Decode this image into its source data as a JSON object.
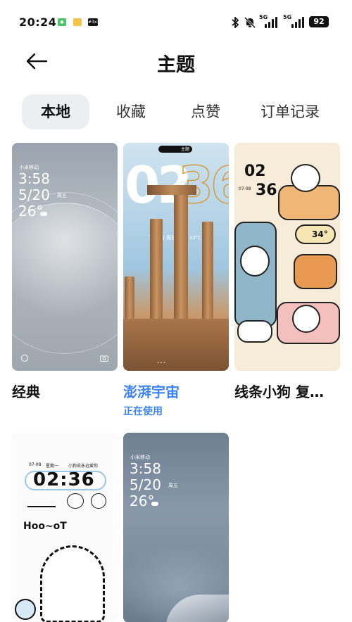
{
  "status_bar": {
    "time": "20:24",
    "notif_badge_3": "#3x3",
    "signal1_label": "5G",
    "signal2_label": "5G",
    "battery": "92"
  },
  "header": {
    "title": "主题"
  },
  "tabs": [
    {
      "label": "本地",
      "active": true
    },
    {
      "label": "收藏",
      "active": false
    },
    {
      "label": "点赞",
      "active": false
    },
    {
      "label": "订单记录",
      "active": false
    }
  ],
  "themes": [
    {
      "name": "经典",
      "status": "",
      "preview": {
        "operator": "小米移动",
        "time": "3:58",
        "date": "5/20",
        "weekday": "周五",
        "temp": "26°"
      }
    },
    {
      "name": "澎湃宇宙",
      "status": "正在使用",
      "preview": {
        "hour": "02",
        "minute": "36",
        "date_line": "7月7日 周日 多云 33°C",
        "island_text": "主题"
      }
    },
    {
      "name": "线条小狗 复…",
      "status": "",
      "preview": {
        "hour": "02",
        "minute": "36",
        "date": "07-08",
        "weather": "34°"
      }
    },
    {
      "name": "",
      "status": "",
      "preview": {
        "date": "07-08",
        "weekday": "星期一",
        "tagline": "小狗说永远爱你",
        "time": "02:36",
        "greeting": "Hoo~oT"
      }
    },
    {
      "name": "",
      "status": "",
      "preview": {
        "operator": "小米移动",
        "time": "3:58",
        "date": "5/20",
        "weekday": "周五",
        "temp": "26°"
      }
    }
  ]
}
